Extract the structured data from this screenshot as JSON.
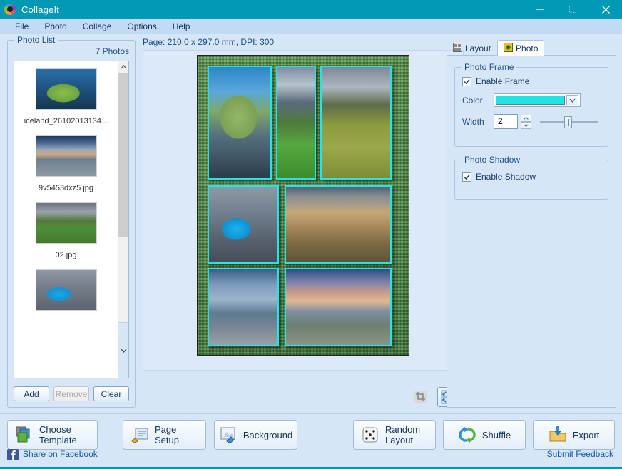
{
  "window": {
    "title": "CollageIt",
    "app_icon": "collageit-logo-icon",
    "minimize": "minimize-icon",
    "maximize": "maximize-icon",
    "close": "close-icon"
  },
  "menubar": {
    "items": [
      {
        "label": "File"
      },
      {
        "label": "Photo"
      },
      {
        "label": "Collage"
      },
      {
        "label": "Options"
      },
      {
        "label": "Help"
      }
    ]
  },
  "photo_list": {
    "title": "Photo List",
    "count_label": "7 Photos",
    "items": [
      {
        "filename": "iceland_26102013134...",
        "thumb": "t1"
      },
      {
        "filename": "9v5453dxz5.jpg",
        "thumb": "t2"
      },
      {
        "filename": "02.jpg",
        "thumb": "t3"
      },
      {
        "filename": "",
        "thumb": "t4"
      }
    ],
    "buttons": {
      "add": "Add",
      "remove": "Remove",
      "clear": "Clear"
    },
    "remove_disabled": true
  },
  "center": {
    "page_info": "Page: 210.0 x 297.0 mm, DPI: 300",
    "tools": [
      {
        "name": "crop-icon",
        "enabled": false
      },
      {
        "name": "fit-to-page-icon",
        "enabled": true
      }
    ],
    "collage": {
      "background": "#4f8b45",
      "frame_color": "#24e5e5",
      "cells": [
        {
          "id": "cell-1",
          "thumb": "c1"
        },
        {
          "id": "cell-2",
          "thumb": "c2"
        },
        {
          "id": "cell-3",
          "thumb": "c3"
        },
        {
          "id": "cell-4",
          "thumb": "c4"
        },
        {
          "id": "cell-5",
          "thumb": "c5"
        },
        {
          "id": "cell-6",
          "thumb": "c6"
        },
        {
          "id": "cell-7",
          "thumb": "c7"
        }
      ]
    }
  },
  "right_panel": {
    "tabs": [
      {
        "label": "Layout",
        "icon": "layout-icon",
        "active": false
      },
      {
        "label": "Photo",
        "icon": "photo-icon",
        "active": true
      }
    ],
    "photo_frame": {
      "title": "Photo Frame",
      "enable_label": "Enable Frame",
      "enable_checked": true,
      "color_label": "Color",
      "color_value": "#20e3e8",
      "width_label": "Width",
      "width_value": "2"
    },
    "photo_shadow": {
      "title": "Photo Shadow",
      "enable_label": "Enable Shadow",
      "enable_checked": true
    }
  },
  "bottom": {
    "buttons": [
      {
        "label": "Choose Template",
        "icon": "template-icon"
      },
      {
        "label": "Page Setup",
        "icon": "page-setup-icon"
      },
      {
        "label": "Background",
        "icon": "background-icon"
      },
      {
        "label": "Random Layout",
        "icon": "dice-icon"
      },
      {
        "label": "Shuffle",
        "icon": "shuffle-icon"
      },
      {
        "label": "Export",
        "icon": "export-icon"
      }
    ],
    "facebook_link": "Share on Facebook",
    "feedback_link": "Submit Feedback"
  },
  "colors": {
    "titlebar": "#0099b5",
    "menubar": "#c3daf4",
    "panel": "#d6e6f7",
    "accent": "#0099b5",
    "frame_cyan": "#24e5e5"
  }
}
